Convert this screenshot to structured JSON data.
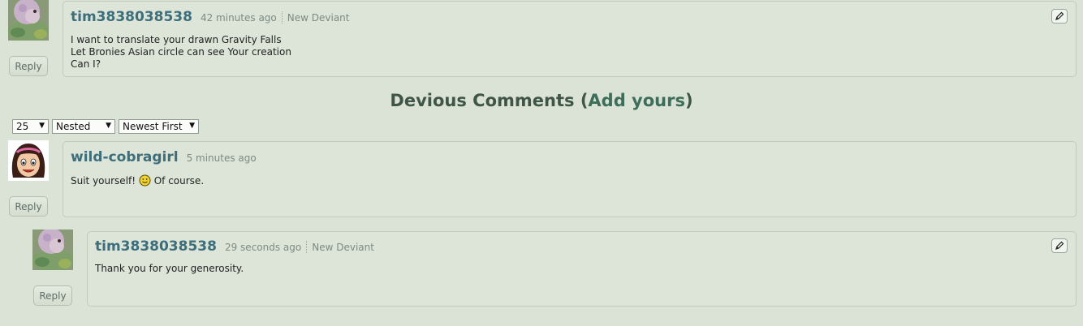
{
  "comments": [
    {
      "username": "tim3838038538",
      "time": "42 minutes ago",
      "rank": "New Deviant",
      "lines": [
        "I want to translate your drawn Gravity Falls",
        "Let Bronies Asian circle can see Your creation",
        "Can I?"
      ],
      "reply_label": "Reply"
    },
    {
      "username": "wild-cobragirl",
      "time": "5 minutes ago",
      "text_before": "Suit yourself!",
      "text_after": "Of course.",
      "reply_label": "Reply"
    },
    {
      "username": "tim3838038538",
      "time": "29 seconds ago",
      "rank": "New Deviant",
      "text": "Thank you for your generosity.",
      "reply_label": "Reply"
    }
  ],
  "section": {
    "title": "Devious Comments",
    "open_paren": "(",
    "add_link": "Add yours",
    "close_paren": ")"
  },
  "controls": {
    "per_page": "25",
    "view_mode": "Nested",
    "sort_order": "Newest First"
  },
  "colors": {
    "background": "#dbe3d7",
    "username": "#3d6e7b",
    "title": "#3f5646"
  },
  "icons": [
    "parrot-avatar",
    "cartoon-girl-avatar",
    "pencil-icon",
    "smiley-icon",
    "dropdown-arrow-icon"
  ]
}
